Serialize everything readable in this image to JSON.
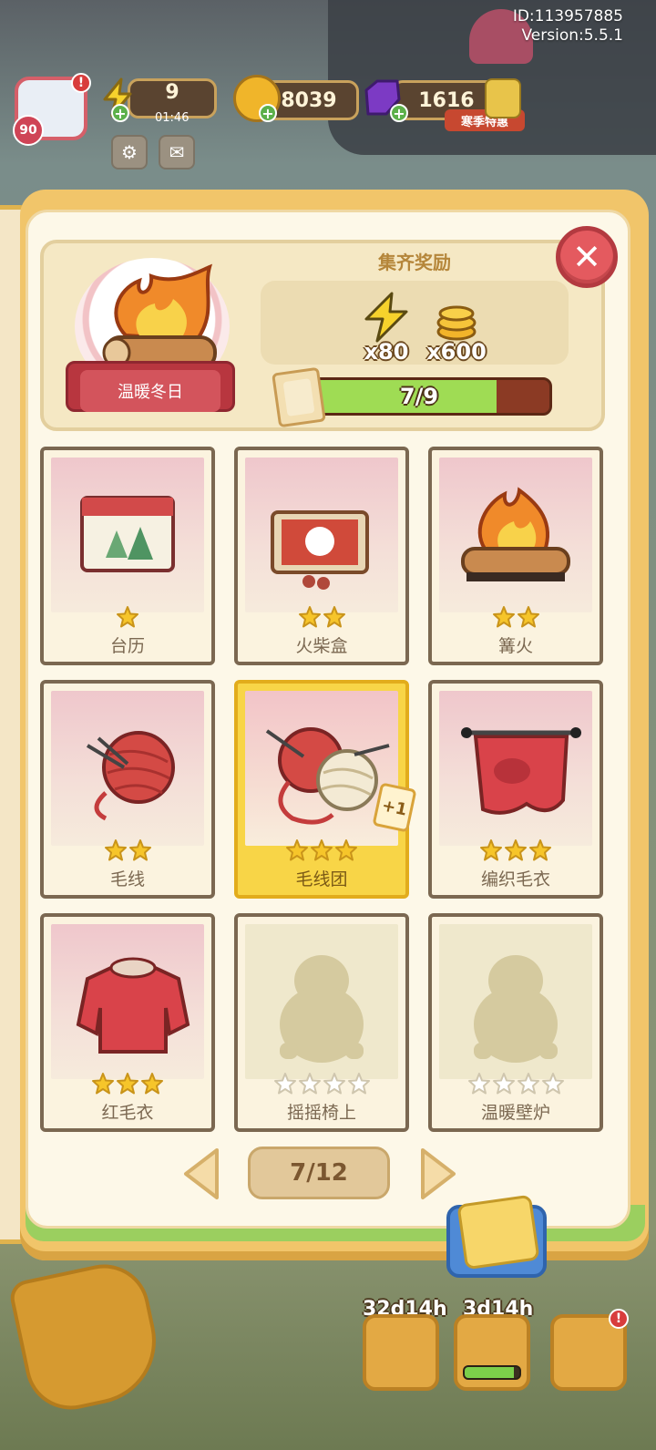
{
  "meta": {
    "id_label": "ID:113957885",
    "version_label": "Version:5.5.1"
  },
  "hud": {
    "avatar_level": "90",
    "energy": {
      "value": "9",
      "timer": "01:46",
      "icon": "lightning-icon"
    },
    "coins": {
      "value": "8039",
      "icon": "coin-icon"
    },
    "gems": {
      "value": "1616",
      "icon": "gem-icon"
    },
    "event_tag": "寒季特惠",
    "buttons": [
      {
        "icon": "gear-icon"
      },
      {
        "icon": "mail-icon"
      }
    ],
    "alert_mark": "!"
  },
  "collection": {
    "title": "温暖冬日",
    "reward_title": "集齐奖励",
    "rewards": [
      {
        "icon": "lightning-icon",
        "amount": "x80"
      },
      {
        "icon": "coin-stack-icon",
        "amount": "x600"
      }
    ],
    "progress": {
      "label": "7/9",
      "collected": 7,
      "total": 9
    },
    "close_icon": "close-icon"
  },
  "cards": [
    {
      "name": "台历",
      "stars": 1,
      "max_stars": 1,
      "state": "owned",
      "icon": "calendar-icon"
    },
    {
      "name": "火柴盒",
      "stars": 2,
      "max_stars": 2,
      "state": "owned",
      "icon": "matchbox-icon"
    },
    {
      "name": "篝火",
      "stars": 2,
      "max_stars": 2,
      "state": "owned",
      "icon": "bonfire-icon"
    },
    {
      "name": "毛线",
      "stars": 2,
      "max_stars": 2,
      "state": "owned",
      "icon": "yarn-ball-icon"
    },
    {
      "name": "毛线团",
      "stars": 3,
      "max_stars": 3,
      "state": "gold",
      "icon": "yarn-balls-icon",
      "badge": "+1"
    },
    {
      "name": "编织毛衣",
      "stars": 3,
      "max_stars": 3,
      "state": "owned",
      "icon": "knitting-icon"
    },
    {
      "name": "红毛衣",
      "stars": 3,
      "max_stars": 3,
      "state": "owned",
      "icon": "sweater-icon"
    },
    {
      "name": "摇摇椅上",
      "stars": 0,
      "max_stars": 4,
      "state": "locked",
      "icon": "silhouette-icon"
    },
    {
      "name": "温暖壁炉",
      "stars": 0,
      "max_stars": 4,
      "state": "locked",
      "icon": "silhouette-icon"
    }
  ],
  "pager": {
    "label": "7/12",
    "prev_icon": "chevron-left-icon",
    "next_icon": "chevron-right-icon"
  },
  "bottom": {
    "timers": [
      "32d14h",
      "3d14h"
    ],
    "mini_progress": 0.9,
    "album_icon": "card-album-icon"
  },
  "colors": {
    "star": "#f6c52a",
    "star_empty": "#ffffff",
    "progress_fill": "#9fdc54",
    "close": "#e45a5f"
  }
}
